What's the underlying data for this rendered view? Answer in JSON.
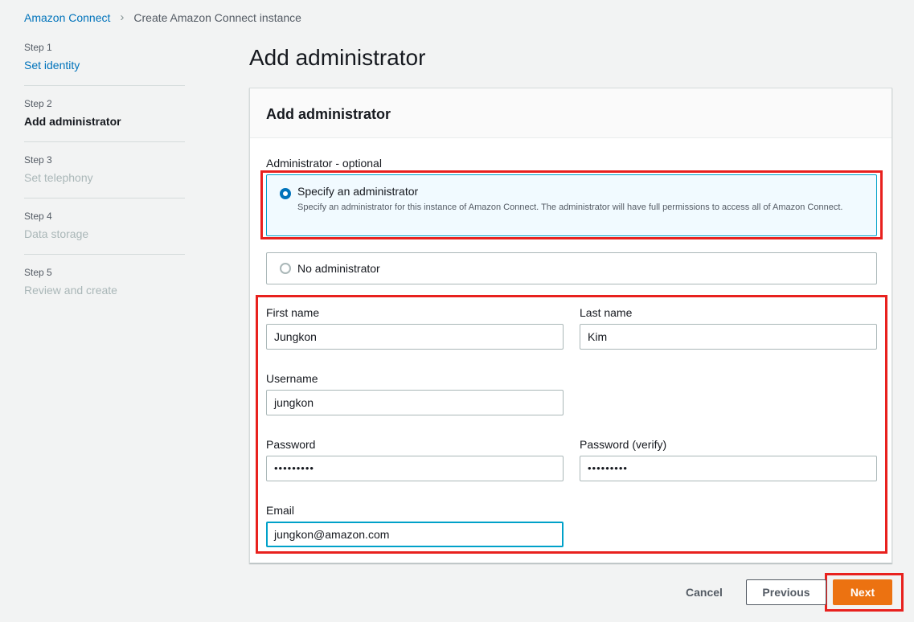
{
  "breadcrumb": {
    "root": "Amazon Connect",
    "current": "Create Amazon Connect instance"
  },
  "steps": [
    {
      "num": "Step 1",
      "name": "Set identity"
    },
    {
      "num": "Step 2",
      "name": "Add administrator"
    },
    {
      "num": "Step 3",
      "name": "Set telephony"
    },
    {
      "num": "Step 4",
      "name": "Data storage"
    },
    {
      "num": "Step 5",
      "name": "Review and create"
    }
  ],
  "page_title": "Add administrator",
  "panel": {
    "title": "Add administrator",
    "admin_label": "Administrator - optional",
    "option_specify": {
      "title": "Specify an administrator",
      "desc": "Specify an administrator for this instance of Amazon Connect. The administrator will have full permissions to access all of Amazon Connect."
    },
    "option_none": {
      "title": "No administrator"
    },
    "fields": {
      "first_name": {
        "label": "First name",
        "value": "Jungkon"
      },
      "last_name": {
        "label": "Last name",
        "value": "Kim"
      },
      "username": {
        "label": "Username",
        "value": "jungkon"
      },
      "password": {
        "label": "Password",
        "value": "•••••••••"
      },
      "password_verify": {
        "label": "Password (verify)",
        "value": "•••••••••"
      },
      "email": {
        "label": "Email",
        "value": "jungkon@amazon.com"
      }
    }
  },
  "actions": {
    "cancel": "Cancel",
    "previous": "Previous",
    "next": "Next"
  },
  "colors": {
    "primary": "#ec7211",
    "link": "#0073bb",
    "highlight": "#e8211e"
  }
}
